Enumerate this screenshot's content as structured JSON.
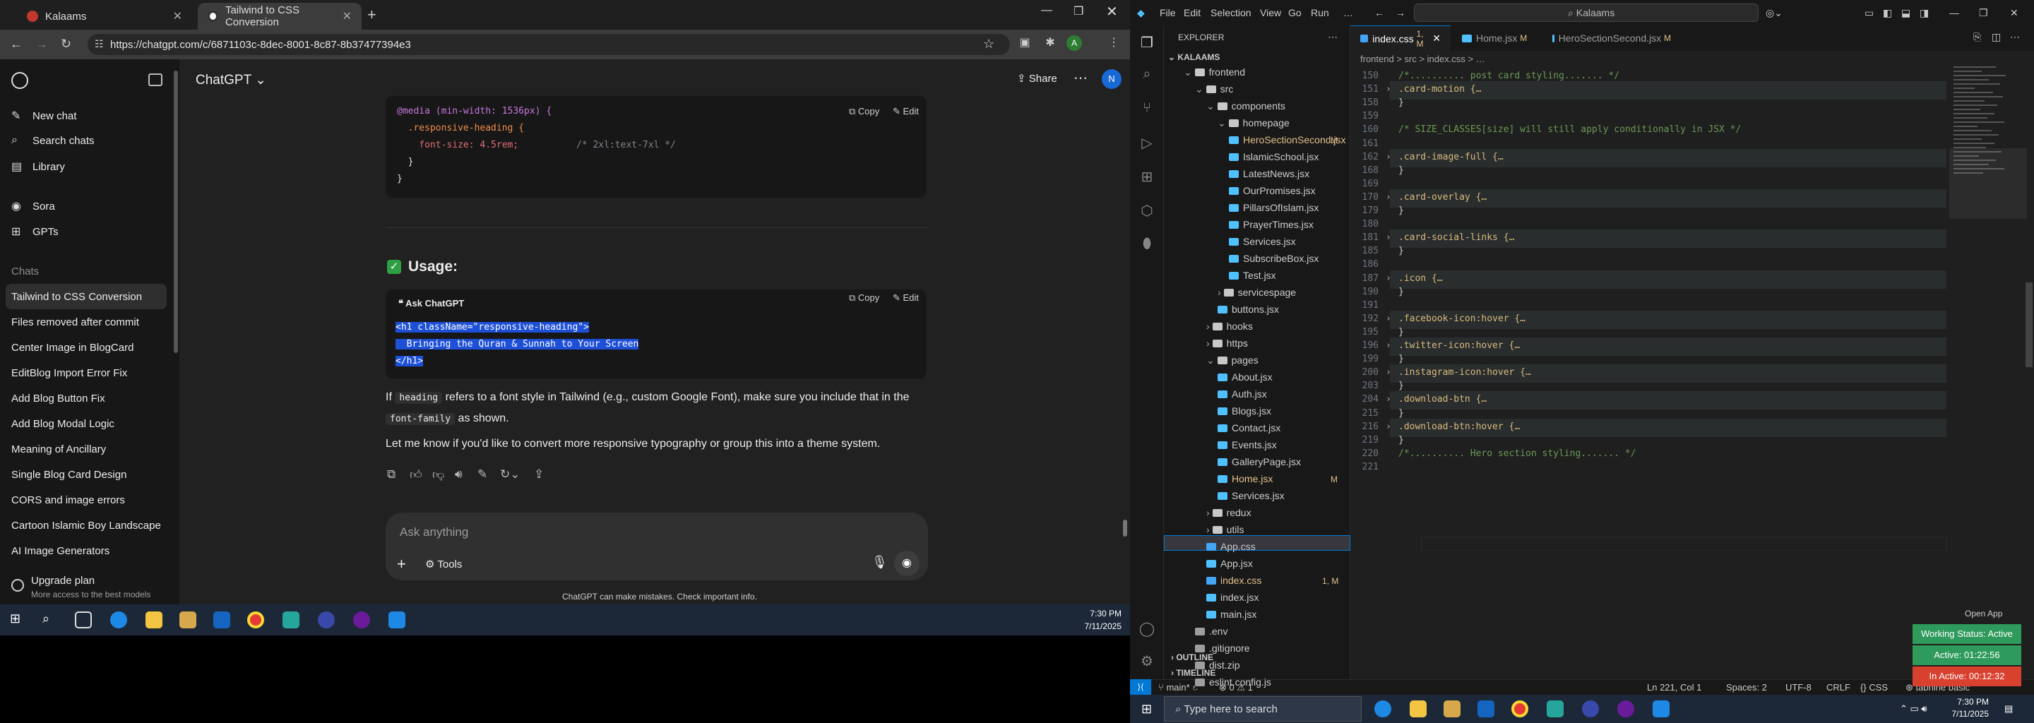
{
  "browser": {
    "tabs": [
      {
        "label": "Kalaams"
      },
      {
        "label": "Tailwind to CSS Conversion"
      }
    ],
    "url": "https://chatgpt.com/c/6871103c-8dec-8001-8c87-8b37477394e3"
  },
  "sidebar": {
    "top_items": [
      {
        "label": "New chat",
        "icon": "edit-icon"
      },
      {
        "label": "Search chats",
        "icon": "search-icon"
      },
      {
        "label": "Library",
        "icon": "library-icon"
      },
      {
        "label": "Sora",
        "icon": "sora-icon"
      },
      {
        "label": "GPTs",
        "icon": "grid-icon"
      }
    ],
    "chats_header": "Chats",
    "chats": [
      "Tailwind to CSS Conversion",
      "Files removed after commit",
      "Center Image in BlogCard",
      "EditBlog Import Error Fix",
      "Add Blog Button Fix",
      "Add Blog Modal Logic",
      "Meaning of Ancillary",
      "Single Blog Card Design",
      "CORS and image errors",
      "Cartoon Islamic Boy Landscape",
      "AI Image Generators"
    ],
    "upgrade_title": "Upgrade plan",
    "upgrade_sub": "More access to the best models"
  },
  "chatgpt": {
    "title": "ChatGPT",
    "share": "Share",
    "avatar": "N",
    "code1": {
      "copy": "Copy",
      "edit": "Edit",
      "l1": "@media (min-width: 1536px) {",
      "l2": "  .responsive-heading {",
      "l3": "    font-size: 4.5rem;",
      "l3c": "/* 2xl:text-7xl */",
      "l4": "  }",
      "l5": "}"
    },
    "usage_heading": "Usage:",
    "code2": {
      "label": "Ask ChatGPT",
      "copy": "Copy",
      "edit": "Edit",
      "l1": "<h1 className=\"responsive-heading\">",
      "l2": "  Bringing the Quran & Sunnah to Your Screen",
      "l3": "</h1>"
    },
    "para1_a": "If ",
    "para1_code1": "heading",
    "para1_b": " refers to a font style in Tailwind (e.g., custom Google Font), make sure you include that in the",
    "para1_code2": "font-family",
    "para1_c": " as shown.",
    "para2": "Let me know if you'd like to convert more responsive typography or group this into a theme system.",
    "composer_placeholder": "Ask anything",
    "tools": "Tools",
    "disclaimer": "ChatGPT can make mistakes. Check important info."
  },
  "taskbar_left": {
    "time": "7:30 PM",
    "date": "7/11/2025"
  },
  "vscode": {
    "menu": [
      "File",
      "Edit",
      "Selection",
      "View",
      "Go",
      "Run",
      "…"
    ],
    "search": "Kalaams",
    "explorer_header": "EXPLORER",
    "project": "KALAAMS",
    "tree": [
      {
        "label": "frontend",
        "depth": 1,
        "kind": "folder",
        "open": true
      },
      {
        "label": "src",
        "depth": 2,
        "kind": "folder",
        "open": true
      },
      {
        "label": "components",
        "depth": 3,
        "kind": "folder",
        "open": true
      },
      {
        "label": "homepage",
        "depth": 4,
        "kind": "folder",
        "open": true
      },
      {
        "label": "HeroSectionSecond.jsx",
        "depth": 5,
        "kind": "jsx",
        "badge": "M"
      },
      {
        "label": "IslamicSchool.jsx",
        "depth": 5,
        "kind": "jsx"
      },
      {
        "label": "LatestNews.jsx",
        "depth": 5,
        "kind": "jsx"
      },
      {
        "label": "OurPromises.jsx",
        "depth": 5,
        "kind": "jsx"
      },
      {
        "label": "PillarsOfIslam.jsx",
        "depth": 5,
        "kind": "jsx"
      },
      {
        "label": "PrayerTimes.jsx",
        "depth": 5,
        "kind": "jsx"
      },
      {
        "label": "Services.jsx",
        "depth": 5,
        "kind": "jsx"
      },
      {
        "label": "SubscribeBox.jsx",
        "depth": 5,
        "kind": "jsx"
      },
      {
        "label": "Test.jsx",
        "depth": 5,
        "kind": "jsx"
      },
      {
        "label": "servicespage",
        "depth": 4,
        "kind": "folder"
      },
      {
        "label": "buttons.jsx",
        "depth": 4,
        "kind": "jsx"
      },
      {
        "label": "hooks",
        "depth": 3,
        "kind": "folder"
      },
      {
        "label": "https",
        "depth": 3,
        "kind": "folder"
      },
      {
        "label": "pages",
        "depth": 3,
        "kind": "folder",
        "open": true
      },
      {
        "label": "About.jsx",
        "depth": 4,
        "kind": "jsx"
      },
      {
        "label": "Auth.jsx",
        "depth": 4,
        "kind": "jsx"
      },
      {
        "label": "Blogs.jsx",
        "depth": 4,
        "kind": "jsx"
      },
      {
        "label": "Contact.jsx",
        "depth": 4,
        "kind": "jsx"
      },
      {
        "label": "Events.jsx",
        "depth": 4,
        "kind": "jsx"
      },
      {
        "label": "GalleryPage.jsx",
        "depth": 4,
        "kind": "jsx"
      },
      {
        "label": "Home.jsx",
        "depth": 4,
        "kind": "jsx",
        "badge": "M"
      },
      {
        "label": "Services.jsx",
        "depth": 4,
        "kind": "jsx"
      },
      {
        "label": "redux",
        "depth": 3,
        "kind": "folder"
      },
      {
        "label": "utils",
        "depth": 3,
        "kind": "folder"
      },
      {
        "label": "App.css",
        "depth": 3,
        "kind": "css"
      },
      {
        "label": "App.jsx",
        "depth": 3,
        "kind": "jsx"
      },
      {
        "label": "index.css",
        "depth": 3,
        "kind": "css",
        "badge": "1, M"
      },
      {
        "label": "index.jsx",
        "depth": 3,
        "kind": "jsx"
      },
      {
        "label": "main.jsx",
        "depth": 3,
        "kind": "jsx"
      },
      {
        "label": ".env",
        "depth": 2,
        "kind": "file"
      },
      {
        "label": ".gitignore",
        "depth": 2,
        "kind": "file"
      },
      {
        "label": "dist.zip",
        "depth": 2,
        "kind": "file"
      },
      {
        "label": "eslint.config.js",
        "depth": 2,
        "kind": "file"
      }
    ],
    "outline": "OUTLINE",
    "timeline": "TIMELINE",
    "tabs": [
      {
        "label": "index.css",
        "badge": "1, M",
        "active": true
      },
      {
        "label": "Home.jsx",
        "badge": "M"
      },
      {
        "label": "HeroSectionSecond.jsx",
        "badge": "M"
      }
    ],
    "breadcrumb": "frontend  >  src  >  index.css  >  …",
    "code": [
      {
        "n": "150",
        "t": "/*.......... post card styling....... */",
        "k": "comment"
      },
      {
        "n": "151",
        "t": ".card-motion {…",
        "k": "fold"
      },
      {
        "n": "158",
        "t": "}",
        "k": "plain"
      },
      {
        "n": "159",
        "t": "",
        "k": "plain"
      },
      {
        "n": "160",
        "t": "/* SIZE_CLASSES[size] will still apply conditionally in JSX */",
        "k": "comment"
      },
      {
        "n": "161",
        "t": "",
        "k": "plain"
      },
      {
        "n": "162",
        "t": ".card-image-full {…",
        "k": "fold"
      },
      {
        "n": "168",
        "t": "}",
        "k": "plain"
      },
      {
        "n": "169",
        "t": "",
        "k": "plain"
      },
      {
        "n": "170",
        "t": ".card-overlay {…",
        "k": "fold"
      },
      {
        "n": "179",
        "t": "}",
        "k": "plain"
      },
      {
        "n": "180",
        "t": "",
        "k": "plain"
      },
      {
        "n": "181",
        "t": ".card-social-links {…",
        "k": "fold"
      },
      {
        "n": "185",
        "t": "}",
        "k": "plain"
      },
      {
        "n": "186",
        "t": "",
        "k": "plain"
      },
      {
        "n": "187",
        "t": ".icon {…",
        "k": "fold"
      },
      {
        "n": "190",
        "t": "}",
        "k": "plain"
      },
      {
        "n": "191",
        "t": "",
        "k": "plain"
      },
      {
        "n": "192",
        "t": ".facebook-icon:hover {…",
        "k": "fold"
      },
      {
        "n": "195",
        "t": "}",
        "k": "plain"
      },
      {
        "n": "196",
        "t": ".twitter-icon:hover {…",
        "k": "fold"
      },
      {
        "n": "199",
        "t": "}",
        "k": "plain"
      },
      {
        "n": "200",
        "t": ".instagram-icon:hover {…",
        "k": "fold"
      },
      {
        "n": "203",
        "t": "}",
        "k": "plain"
      },
      {
        "n": "204",
        "t": ".download-btn {…",
        "k": "fold"
      },
      {
        "n": "215",
        "t": "}",
        "k": "plain"
      },
      {
        "n": "216",
        "t": ".download-btn:hover {…",
        "k": "fold"
      },
      {
        "n": "219",
        "t": "}",
        "k": "plain"
      },
      {
        "n": "220",
        "t": "/*.......... Hero section styling....... */",
        "k": "comment"
      },
      {
        "n": "221",
        "t": "",
        "k": "plain"
      }
    ],
    "status": {
      "branch": "main*",
      "problems": "0  ⚠ 1",
      "position": "Ln 221, Col 1",
      "spaces": "Spaces: 2",
      "encoding": "UTF-8",
      "eol": "CRLF",
      "lang": "CSS",
      "tabnine": "tabnine basic"
    }
  },
  "working_status": {
    "open_app": "Open App",
    "status": "Working Status: Active",
    "active": "Active: 01:22:56",
    "inactive": "In Active: 00:12:32"
  },
  "taskbar_right": {
    "search": "Type here to search",
    "time": "7:30 PM",
    "date": "7/11/2025"
  }
}
